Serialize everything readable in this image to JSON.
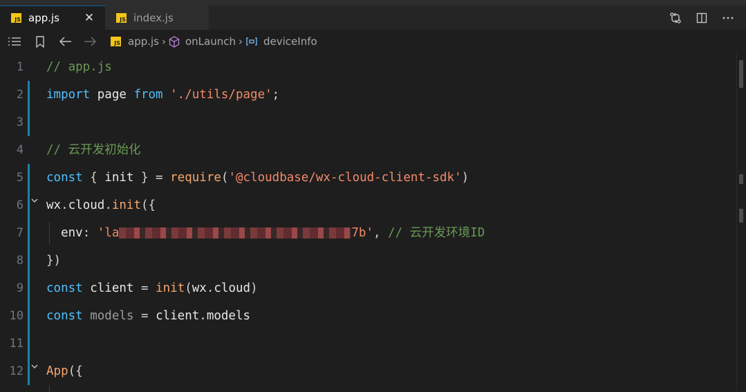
{
  "tabs": [
    {
      "label": "app.js",
      "badge": "JS",
      "active": true
    },
    {
      "label": "index.js",
      "badge": "JS",
      "active": false
    }
  ],
  "tab_close_glyph": "✕",
  "breadcrumb": {
    "file": "app.js",
    "file_badge": "JS",
    "method": "onLaunch",
    "property": "deviceInfo",
    "separator": "›"
  },
  "code_lines": [
    {
      "n": "1",
      "parts": [
        {
          "t": "// app.js",
          "c": "comment"
        }
      ]
    },
    {
      "n": "2",
      "parts": [
        {
          "t": "import",
          "c": "kw"
        },
        {
          "t": " page ",
          "c": "var"
        },
        {
          "t": "from",
          "c": "kw"
        },
        {
          "t": " ",
          "c": "punc"
        },
        {
          "t": "'./utils/page'",
          "c": "str"
        },
        {
          "t": ";",
          "c": "punc"
        }
      ]
    },
    {
      "n": "3",
      "parts": []
    },
    {
      "n": "4",
      "parts": [
        {
          "t": "// 云开发初始化",
          "c": "comment"
        }
      ]
    },
    {
      "n": "5",
      "parts": [
        {
          "t": "const",
          "c": "kw"
        },
        {
          "t": " { ",
          "c": "punc"
        },
        {
          "t": "init",
          "c": "var"
        },
        {
          "t": " } = ",
          "c": "punc"
        },
        {
          "t": "require",
          "c": "fn"
        },
        {
          "t": "(",
          "c": "punc"
        },
        {
          "t": "'@cloudbase/wx-cloud-client-sdk'",
          "c": "str"
        },
        {
          "t": ")",
          "c": "punc"
        }
      ]
    },
    {
      "n": "6",
      "parts": [
        {
          "t": "wx",
          "c": "var"
        },
        {
          "t": ".",
          "c": "punc"
        },
        {
          "t": "cloud",
          "c": "var"
        },
        {
          "t": ".",
          "c": "punc"
        },
        {
          "t": "init",
          "c": "fn"
        },
        {
          "t": "({",
          "c": "punc"
        }
      ]
    },
    {
      "n": "7",
      "parts": [
        {
          "t": "  env",
          "c": "var"
        },
        {
          "t": ": ",
          "c": "punc"
        },
        {
          "t": "'la",
          "c": "str"
        },
        {
          "t": "",
          "c": "redact"
        },
        {
          "t": "7b'",
          "c": "str"
        },
        {
          "t": ", ",
          "c": "punc"
        },
        {
          "t": "// 云开发环境ID",
          "c": "comment"
        }
      ]
    },
    {
      "n": "8",
      "parts": [
        {
          "t": "})",
          "c": "punc"
        }
      ]
    },
    {
      "n": "9",
      "parts": [
        {
          "t": "const",
          "c": "kw"
        },
        {
          "t": " client ",
          "c": "var"
        },
        {
          "t": "= ",
          "c": "punc"
        },
        {
          "t": "init",
          "c": "fn"
        },
        {
          "t": "(",
          "c": "punc"
        },
        {
          "t": "wx",
          "c": "var"
        },
        {
          "t": ".",
          "c": "punc"
        },
        {
          "t": "cloud",
          "c": "var"
        },
        {
          "t": ")",
          "c": "punc"
        }
      ]
    },
    {
      "n": "10",
      "parts": [
        {
          "t": "const",
          "c": "kw"
        },
        {
          "t": " models ",
          "c": "gray"
        },
        {
          "t": "= ",
          "c": "punc"
        },
        {
          "t": "client",
          "c": "var"
        },
        {
          "t": ".",
          "c": "punc"
        },
        {
          "t": "models",
          "c": "var"
        }
      ]
    },
    {
      "n": "11",
      "parts": []
    },
    {
      "n": "12",
      "parts": [
        {
          "t": "App",
          "c": "fn"
        },
        {
          "t": "({",
          "c": "punc"
        }
      ]
    }
  ],
  "fold_markers": [
    "6",
    "12"
  ],
  "colors": {
    "background": "#1e1e1e",
    "comment": "#6a9955",
    "keyword": "#4fc1ff",
    "string": "#f28b6a",
    "function": "#f6a66e",
    "gutter_mark": "#1b81a8"
  }
}
